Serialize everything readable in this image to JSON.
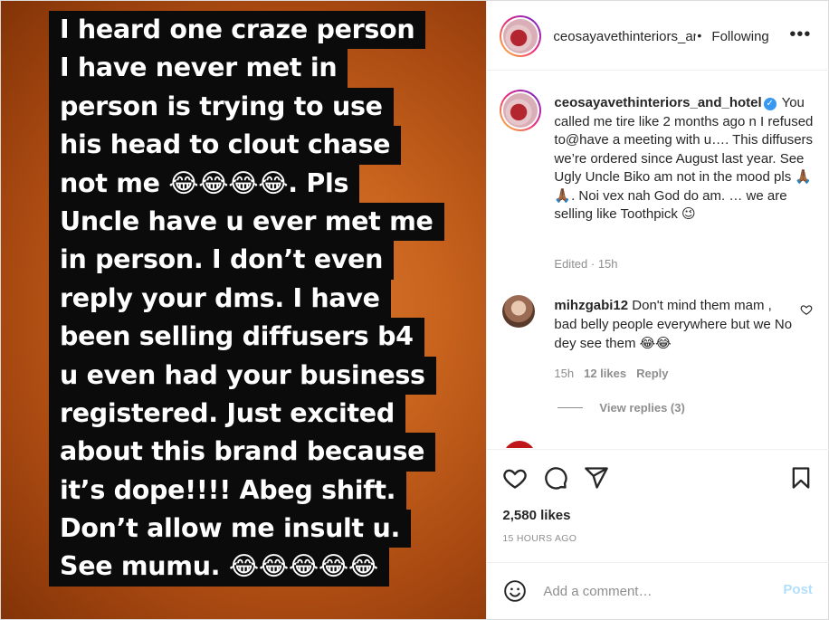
{
  "media": {
    "lines": [
      "I heard one craze person",
      "I have never met in",
      "person is trying to use",
      "his head to clout chase",
      "not me 😂😂😂😂.  Pls",
      "Uncle have u ever met me",
      "in person. I don’t even",
      "reply your dms.  I have",
      "been selling diffusers b4",
      "u even had your business",
      "registered.  Just excited",
      "about this brand because",
      "it’s dope!!!!  Abeg shift.",
      "Don’t allow me insult u.",
      "See mumu. 😂😂😂😂😂"
    ]
  },
  "header": {
    "username": "ceosayavethinteriors_and_hotel",
    "dot": "•",
    "follow_label": "Following",
    "more_label": "•••"
  },
  "caption": {
    "username": "ceosayavethinteriors_and_hotel",
    "text": "You called me tire like 2 months ago n I refused to@have a meeting with u…. This diffusers we’re ordered since August last year. See Ugly Uncle Biko am not in the mood pls 🙏🏾🙏🏾. Noi vex nah God do am. … we are selling like Toothpick 😉",
    "meta": "Edited · 15h"
  },
  "comment1": {
    "username": "mihzgabi12",
    "text": "Don't mind them mam , bad belly people everywhere but we No dey see them 😂😂",
    "time": "15h",
    "likes": "12 likes",
    "reply_label": "Reply",
    "view_replies": "View replies (3)"
  },
  "comment2": {
    "text": "... ... ... ... ... ..."
  },
  "actions": {
    "likes_count": "2,580 likes",
    "time_ago": "15 HOURS AGO"
  },
  "add_comment": {
    "placeholder": "Add a comment…",
    "post_label": "Post"
  },
  "colors": {
    "verified": "#3897f0",
    "post_button": "#b2dffc",
    "muted_text": "#8e8e8e"
  }
}
